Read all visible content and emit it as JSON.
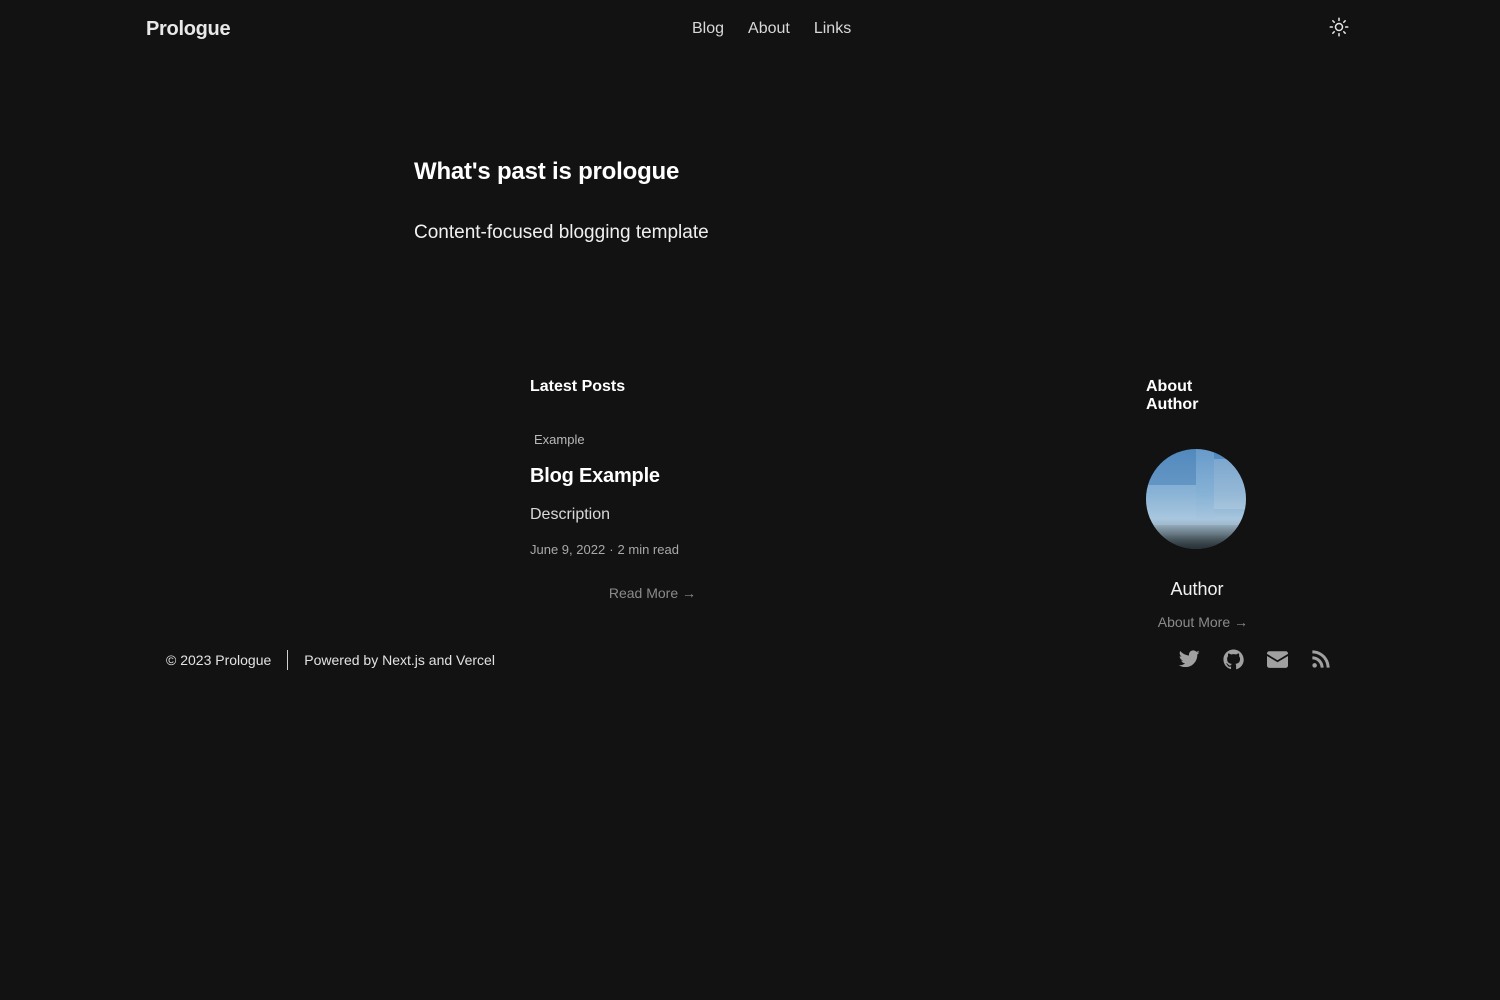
{
  "header": {
    "brand": "Prologue",
    "nav": [
      "Blog",
      "About",
      "Links"
    ],
    "theme_icon": "sun-icon"
  },
  "hero": {
    "title": "What's past is prologue",
    "subtitle": "Content-focused blogging template"
  },
  "latest_posts": {
    "heading": "Latest Posts",
    "post": {
      "tag": "Example",
      "title": "Blog Example",
      "description": "Description",
      "date": "June 9, 2022",
      "separator": "·",
      "read_time": "2 min read",
      "read_more": "Read More →"
    }
  },
  "about_author": {
    "heading": "About Author",
    "name": "Author",
    "about_more": "About More →"
  },
  "footer": {
    "copyright": "© 2023 Prologue",
    "powered_by": "Powered by Next.js and Vercel",
    "social_icons": [
      "twitter-icon",
      "github-icon",
      "mail-icon",
      "rss-icon"
    ],
    "icon_color": "#a0a0a0"
  },
  "colors": {
    "background": "#121212",
    "text": "#ffffff",
    "muted": "#8a8a8a"
  }
}
